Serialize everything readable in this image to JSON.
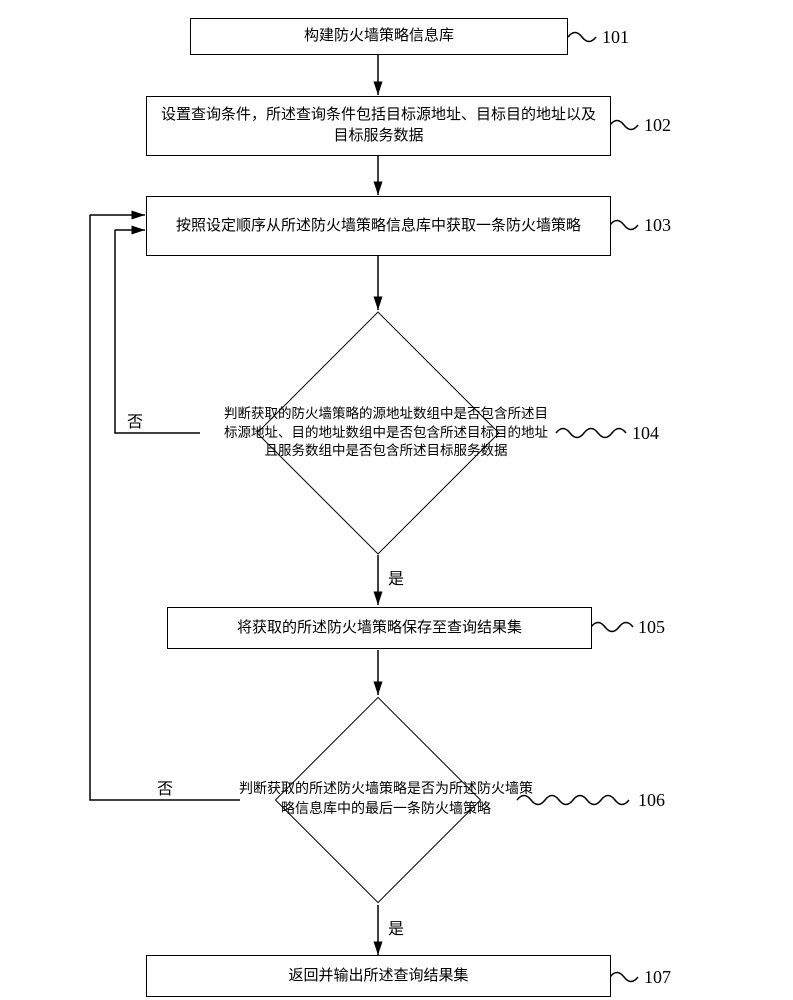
{
  "steps": {
    "s101": {
      "num": "101",
      "text": "构建防火墙策略信息库"
    },
    "s102": {
      "num": "102",
      "text": "设置查询条件，所述查询条件包括目标源地址、目标目的地址以及目标服务数据"
    },
    "s103": {
      "num": "103",
      "text": "按照设定顺序从所述防火墙策略信息库中获取一条防火墙策略"
    },
    "s104": {
      "num": "104",
      "text": "判断获取的防火墙策略的源地址数组中是否包含所述目标源地址、目的地址数组中是否包含所述目标目的地址且服务数组中是否包含所述目标服务数据"
    },
    "s105": {
      "num": "105",
      "text": "将获取的所述防火墙策略保存至查询结果集"
    },
    "s106": {
      "num": "106",
      "text": "判断获取的所述防火墙策略是否为所述防火墙策略信息库中的最后一条防火墙策略"
    },
    "s107": {
      "num": "107",
      "text": "返回并输出所述查询结果集"
    }
  },
  "labels": {
    "yes": "是",
    "no": "否"
  }
}
